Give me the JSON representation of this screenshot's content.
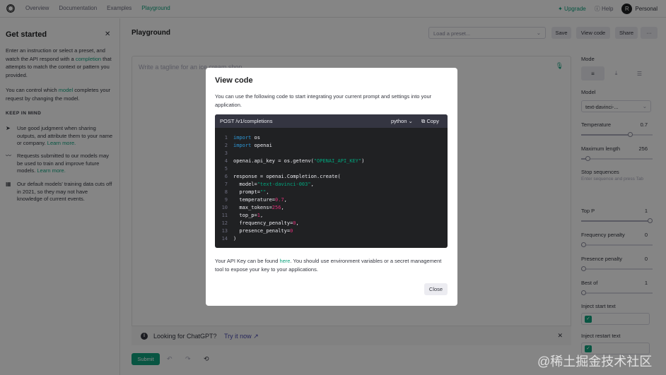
{
  "nav": {
    "links": [
      "Overview",
      "Documentation",
      "Examples",
      "Playground"
    ],
    "active": "Playground",
    "upgrade": "Upgrade",
    "help": "Help",
    "avatar_letter": "R",
    "personal": "Personal"
  },
  "sidebar": {
    "title": "Get started",
    "intro_pre": "Enter an instruction or select a preset, and watch the API respond with a ",
    "intro_link": "completion",
    "intro_post": " that attempts to match the context or pattern you provided.",
    "control_pre": "You can control which ",
    "control_link": "model",
    "control_post": " completes your request by changing the model.",
    "keep_in_mind": "KEEP IN MIND",
    "tips": [
      {
        "icon": "send-icon",
        "text": "Use good judgment when sharing outputs, and attribute them to your name or company. ",
        "link": "Learn more."
      },
      {
        "icon": "activity-icon",
        "text": "Requests submitted to our models may be used to train and improve future models. ",
        "link": "Learn more."
      },
      {
        "icon": "calendar-icon",
        "text": "Our default models' training data cuts off in 2021, so they may not have knowledge of current events.",
        "link": ""
      }
    ]
  },
  "main": {
    "title": "Playground",
    "preset_placeholder": "Load a preset...",
    "save": "Save",
    "view_code": "View code",
    "share": "Share",
    "more": "···",
    "editor_placeholder": "Write a tagline for an ice cream shop.",
    "banner_text": "Looking for ChatGPT?",
    "banner_link": "Try it now",
    "submit": "Submit"
  },
  "settings": {
    "mode": "Mode",
    "model_label": "Model",
    "model_value": "text-davinci-...",
    "temperature": {
      "label": "Temperature",
      "value": "0.7",
      "fraction": 0.7
    },
    "max_length": {
      "label": "Maximum length",
      "value": "256",
      "fraction": 0.06
    },
    "stop_label": "Stop sequences",
    "stop_placeholder": "Enter sequence and press Tab",
    "top_p": {
      "label": "Top P",
      "value": "1",
      "fraction": 1.0
    },
    "freq": {
      "label": "Frequency penalty",
      "value": "0",
      "fraction": 0.0
    },
    "pres": {
      "label": "Presence penalty",
      "value": "0",
      "fraction": 0.0
    },
    "best_of": {
      "label": "Best of",
      "value": "1",
      "fraction": 0.0
    },
    "inject_start": "Inject start text",
    "inject_restart": "Inject restart text"
  },
  "modal": {
    "title": "View code",
    "intro": "You can use the following code to start integrating your current prompt and settings into your application.",
    "endpoint": "POST /v1/completions",
    "language": "python",
    "copy": "Copy",
    "note_pre": "Your API Key can be found ",
    "note_link": "here",
    "note_post": ". You should use environment variables or a secret management tool to expose your key to your applications.",
    "close": "Close",
    "code_lines": [
      [
        [
          "kw",
          "import"
        ],
        [
          "t",
          " os"
        ]
      ],
      [
        [
          "kw",
          "import"
        ],
        [
          "t",
          " openai"
        ]
      ],
      [],
      [
        [
          "t",
          "openai.api_key = os.getenv("
        ],
        [
          "str",
          "\"OPENAI_API_KEY\""
        ],
        [
          "t",
          ")"
        ]
      ],
      [],
      [
        [
          "t",
          "response = openai.Completion.create("
        ]
      ],
      [
        [
          "t",
          "  model="
        ],
        [
          "str",
          "\"text-davinci-003\""
        ],
        [
          "t",
          ","
        ]
      ],
      [
        [
          "t",
          "  prompt="
        ],
        [
          "str",
          "\"\""
        ],
        [
          "t",
          ","
        ]
      ],
      [
        [
          "t",
          "  temperature="
        ],
        [
          "num",
          "0.7"
        ],
        [
          "t",
          ","
        ]
      ],
      [
        [
          "t",
          "  max_tokens="
        ],
        [
          "num",
          "256"
        ],
        [
          "t",
          ","
        ]
      ],
      [
        [
          "t",
          "  top_p="
        ],
        [
          "num",
          "1"
        ],
        [
          "t",
          ","
        ]
      ],
      [
        [
          "t",
          "  frequency_penalty="
        ],
        [
          "num",
          "0"
        ],
        [
          "t",
          ","
        ]
      ],
      [
        [
          "t",
          "  presence_penalty="
        ],
        [
          "num",
          "0"
        ]
      ],
      [
        [
          "t",
          ")"
        ]
      ]
    ]
  },
  "watermark": "@稀土掘金技术社区",
  "colors": {
    "accent": "#10a37f",
    "dark": "#202123"
  }
}
